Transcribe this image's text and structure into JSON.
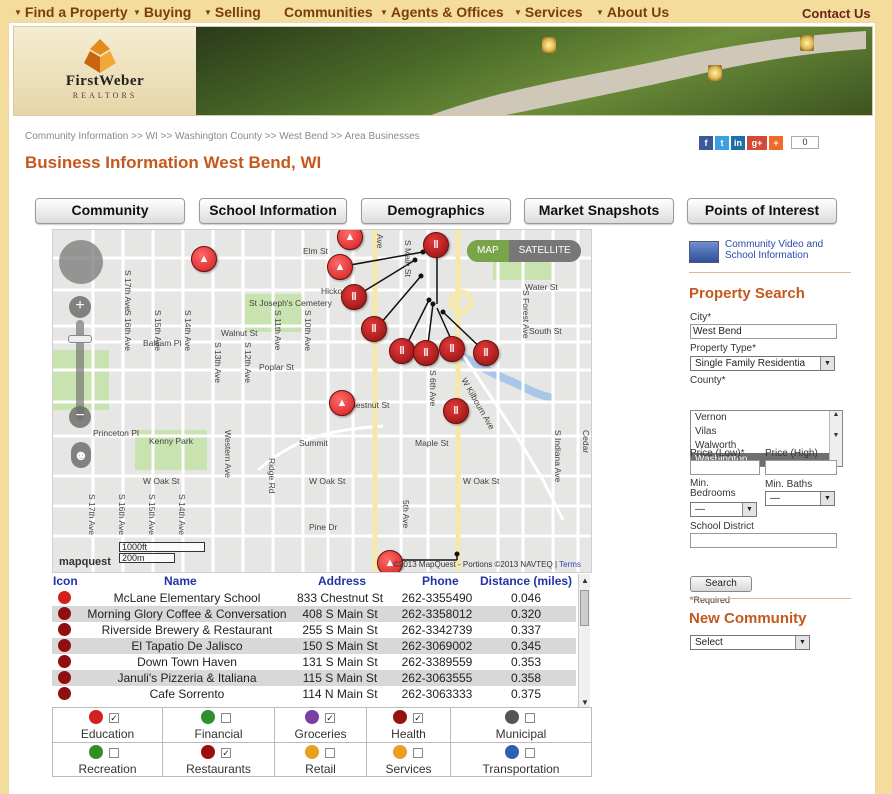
{
  "nav": {
    "items": [
      "Find a Property",
      "Buying",
      "Selling",
      "Communities",
      "Agents & Offices",
      "Services",
      "About Us"
    ],
    "contact": "Contact Us"
  },
  "brand": {
    "name": "FirstWeber",
    "tagline": "REALTORS"
  },
  "breadcrumb": "Community Information >> WI >> Washington County >> West Bend >> Area Businesses",
  "social": {
    "share_count": "0"
  },
  "page_title": "Business Information West Bend, WI",
  "tabs": [
    "Community",
    "School Information",
    "Demographics",
    "Market Snapshots",
    "Points of Interest"
  ],
  "map": {
    "mode_map": "MAP",
    "mode_satellite": "SATELLITE",
    "scale_ft": "1000ft",
    "scale_m": "200m",
    "provider": "mapquest",
    "attribution": "©2013 MapQuest - Portions ©2013 NAVTEQ |",
    "terms": "Terms",
    "street_labels": [
      "Elm St",
      "Hickory",
      "St Joseph's Cemetery",
      "Walnut St",
      "Balsam Pl",
      "Poplar St",
      "Chestnut St",
      "Kenny Park",
      "Maple St",
      "Princeton Pl",
      "W Oak St",
      "Pine Dr",
      "Water St",
      "South St",
      "Western Ave",
      "Ridge Rd",
      "Summit",
      "S 10th Ave",
      "S 11th Ave",
      "S 12th Ave",
      "S 13th Ave",
      "S 14th Ave",
      "S 15th Ave",
      "S 16th Ave",
      "S 17th Ave",
      "5th Ave",
      "S 6th Ave",
      "S Main St",
      "W Kilbourn Ave",
      "S Indiana Ave",
      "S Forest Ave",
      "Ave",
      "St",
      "Cedar"
    ]
  },
  "results": {
    "headers": {
      "icon": "Icon",
      "name": "Name",
      "address": "Address",
      "phone": "Phone",
      "distance": "Distance (miles)"
    },
    "rows": [
      {
        "type": "education",
        "name": "McLane Elementary School",
        "address": "833 Chestnut St",
        "phone": "262-3355490",
        "distance": "0.046"
      },
      {
        "type": "restaurant",
        "name": "Morning Glory Coffee & Conversation",
        "address": "408 S Main St",
        "phone": "262-3358012",
        "distance": "0.320"
      },
      {
        "type": "restaurant",
        "name": "Riverside Brewery & Restaurant",
        "address": "255 S Main St",
        "phone": "262-3342739",
        "distance": "0.337"
      },
      {
        "type": "restaurant",
        "name": "El Tapatio De Jalisco",
        "address": "150 S Main St",
        "phone": "262-3069002",
        "distance": "0.345"
      },
      {
        "type": "restaurant",
        "name": "Down Town Haven",
        "address": "131 S Main St",
        "phone": "262-3389559",
        "distance": "0.353"
      },
      {
        "type": "restaurant",
        "name": "Januli's Pizzeria & Italiana",
        "address": "115 S Main St",
        "phone": "262-3063555",
        "distance": "0.358"
      },
      {
        "type": "restaurant",
        "name": "Cafe Sorrento",
        "address": "114 N Main St",
        "phone": "262-3063333",
        "distance": "0.375"
      }
    ]
  },
  "categories": [
    {
      "label": "Education",
      "checked": true,
      "color": "#d32020"
    },
    {
      "label": "Financial",
      "checked": false,
      "color": "#2f8f2f"
    },
    {
      "label": "Groceries",
      "checked": true,
      "color": "#7a3fa0"
    },
    {
      "label": "Health",
      "checked": true,
      "color": "#9a1010"
    },
    {
      "label": "Municipal",
      "checked": false,
      "color": "#555555"
    },
    {
      "label": "Recreation",
      "checked": false,
      "color": "#2f8f2f"
    },
    {
      "label": "Restaurants",
      "checked": true,
      "color": "#9a1010"
    },
    {
      "label": "Retail",
      "checked": false,
      "color": "#e8a020"
    },
    {
      "label": "Services",
      "checked": false,
      "color": "#e8a020"
    },
    {
      "label": "Transportation",
      "checked": false,
      "color": "#2f5fb0"
    }
  ],
  "sidebar": {
    "video_link": "Community Video and School Information",
    "property_search": {
      "title": "Property Search",
      "city_label": "City*",
      "city_value": "West Bend",
      "type_label": "Property Type*",
      "type_value": "Single Family Residentia",
      "county_label": "County*",
      "counties": [
        "Vernon",
        "Vilas",
        "Walworth",
        "Washington"
      ],
      "county_selected": "Washington",
      "price_low_label": "Price (Low)*",
      "price_high_label": "Price (High)",
      "min_bedrooms_label": "Min. Bedrooms",
      "min_bedrooms_value": "—",
      "min_baths_label": "Min. Baths",
      "min_baths_value": "—",
      "school_district_label": "School District",
      "search_button": "Search",
      "required_note": "*Required"
    },
    "new_community": {
      "title": "New Community",
      "select_value": "Select"
    }
  },
  "colors": {
    "accent": "#c5581e",
    "nav_text": "#7a3d10",
    "link": "#2233a8"
  }
}
